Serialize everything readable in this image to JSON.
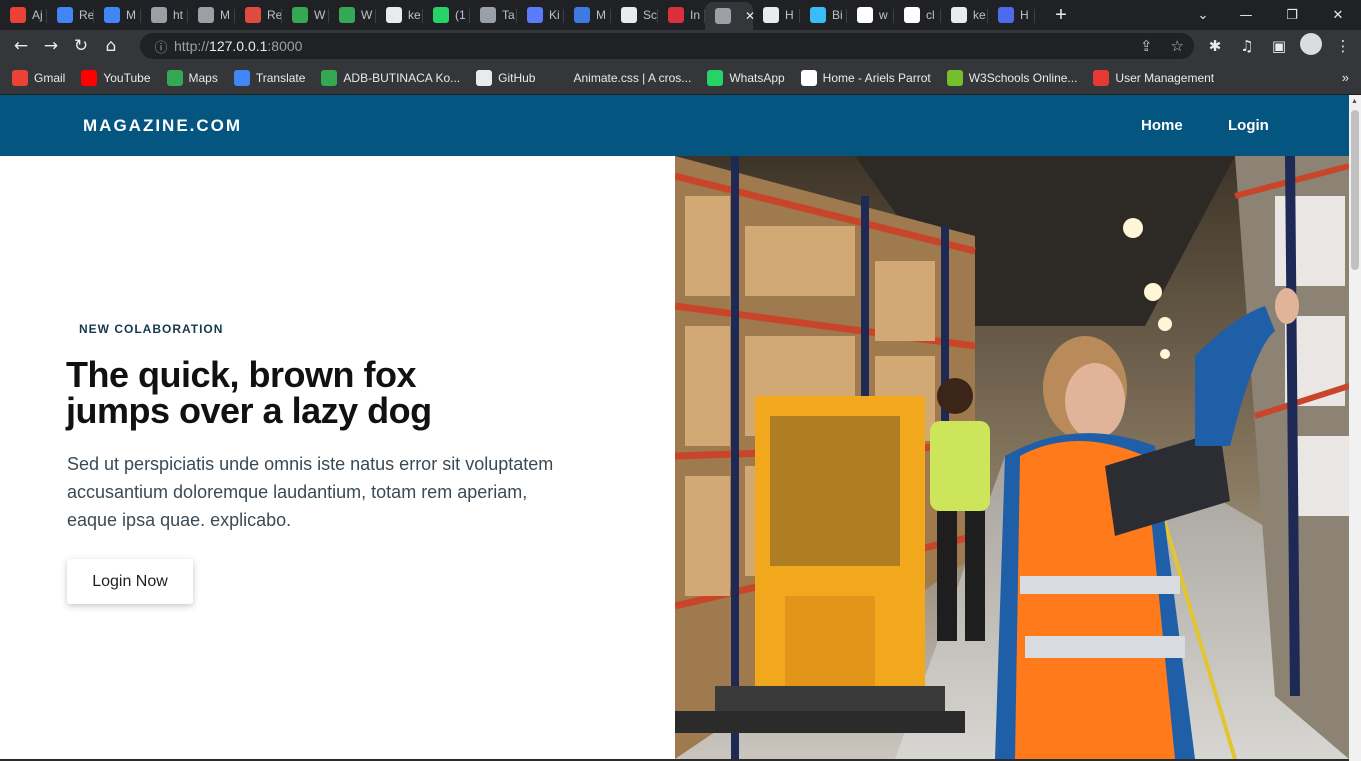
{
  "browser": {
    "tabs": [
      {
        "label": "Aj",
        "favicon": "gmail-icon",
        "color": "#ea4335"
      },
      {
        "label": "Re",
        "favicon": "docs-icon",
        "color": "#4285f4"
      },
      {
        "label": "M",
        "favicon": "docs-icon",
        "color": "#4285f4"
      },
      {
        "label": "ht",
        "favicon": "extension-icon",
        "color": "#9aa0a6"
      },
      {
        "label": "M",
        "favicon": "extension-icon",
        "color": "#9aa0a6"
      },
      {
        "label": "Re",
        "favicon": "r-icon",
        "color": "#e04a3f"
      },
      {
        "label": "W",
        "favicon": "play-icon",
        "color": "#34a853"
      },
      {
        "label": "W",
        "favicon": "play-icon",
        "color": "#34a853"
      },
      {
        "label": "ke",
        "favicon": "github-icon",
        "color": "#e8eaed"
      },
      {
        "label": "(1",
        "favicon": "whatsapp-icon",
        "color": "#25d366"
      },
      {
        "label": "Ta",
        "favicon": "globe-icon",
        "color": "#9aa0a6"
      },
      {
        "label": "Ki",
        "favicon": "k-icon",
        "color": "#5b7cfa"
      },
      {
        "label": "M",
        "favicon": "m-icon",
        "color": "#3d7be0"
      },
      {
        "label": "Sc",
        "favicon": "grid-icon",
        "color": "#e8eaed"
      },
      {
        "label": "In",
        "favicon": "heart-icon",
        "color": "#d9303e"
      },
      {
        "label": "",
        "favicon": "globe-icon",
        "color": "#9aa0a6",
        "active": true
      },
      {
        "label": "H",
        "favicon": "diamond-icon",
        "color": "#e8eaed"
      },
      {
        "label": "Bi",
        "favicon": "wave-icon",
        "color": "#38bdf8"
      },
      {
        "label": "w",
        "favicon": "google-icon",
        "color": "#ffffff"
      },
      {
        "label": "cl",
        "favicon": "google-icon",
        "color": "#ffffff"
      },
      {
        "label": "ke",
        "favicon": "github-icon",
        "color": "#e8eaed"
      },
      {
        "label": "H",
        "favicon": "screen-icon",
        "color": "#4f6bed"
      }
    ],
    "url_prefix": "http://",
    "url_host": "127.0.0.1",
    "url_port": ":8000",
    "bookmarks": [
      {
        "label": "Gmail",
        "icon": "gmail-icon",
        "color": "#ea4335"
      },
      {
        "label": "YouTube",
        "icon": "youtube-icon",
        "color": "#ff0000"
      },
      {
        "label": "Maps",
        "icon": "maps-pin-icon",
        "color": "#34a853"
      },
      {
        "label": "Translate",
        "icon": "translate-icon",
        "color": "#4285f4"
      },
      {
        "label": "ADB-BUTINACA Ko...",
        "icon": "check-circle-icon",
        "color": "#34a853"
      },
      {
        "label": "GitHub",
        "icon": "github-icon",
        "color": "#e8eaed"
      },
      {
        "label": "Animate.css | A cros...",
        "icon": "a-icon",
        "color": "#35363a"
      },
      {
        "label": "WhatsApp",
        "icon": "whatsapp-icon",
        "color": "#25d366"
      },
      {
        "label": "Home - Ariels Parrot",
        "icon": "parrot-icon",
        "color": "#ffffff"
      },
      {
        "label": "W3Schools Online...",
        "icon": "w3schools-icon",
        "color": "#73c02a"
      },
      {
        "label": "User Management",
        "icon": "oracle-icon",
        "color": "#e53935"
      }
    ]
  },
  "site": {
    "brand": "MAGAZINE.COM",
    "nav": {
      "home": "Home",
      "login": "Login"
    },
    "colors": {
      "nav_bg": "#045580",
      "text_dark": "#111111"
    }
  },
  "hero": {
    "eyebrow": "NEW COLABORATION",
    "title_line1": "The quick, brown fox",
    "title_line2": "jumps over a lazy dog",
    "body_line1": "Sed ut perspiciatis unde omnis iste natus error sit voluptatem",
    "body_line2": "accusantium doloremque laudantium, totam rem aperiam,",
    "body_line3": "eaque ipsa quae. explicabo.",
    "cta": "Login Now"
  }
}
